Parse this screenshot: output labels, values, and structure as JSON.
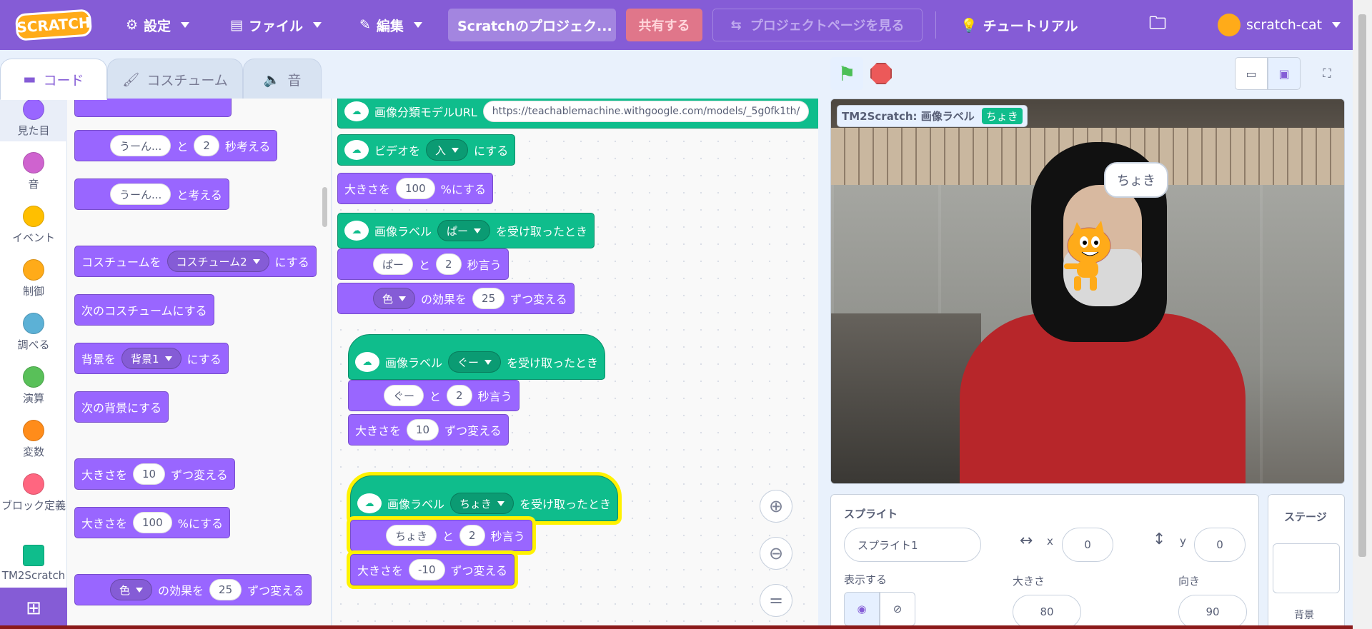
{
  "menubar": {
    "logo": "SCRATCH",
    "settings": "設定",
    "file": "ファイル",
    "edit": "編集",
    "project_title": "Scratchのプロジェク...",
    "share": "共有する",
    "see_project": "プロジェクトページを見る",
    "tutorials": "チュートリアル",
    "username": "scratch-cat"
  },
  "tabs": {
    "code": "コード",
    "costumes": "コスチューム",
    "sounds": "音"
  },
  "categories": [
    {
      "label": "見た目",
      "color": "#9966ff"
    },
    {
      "label": "音",
      "color": "#cf63cf"
    },
    {
      "label": "イベント",
      "color": "#ffbf00"
    },
    {
      "label": "制御",
      "color": "#ffab19"
    },
    {
      "label": "調べる",
      "color": "#5cb1d6"
    },
    {
      "label": "演算",
      "color": "#59c059"
    },
    {
      "label": "変数",
      "color": "#ff8c1a"
    },
    {
      "label": "ブロック定義",
      "color": "#ff6680"
    },
    {
      "label": "TM2Scratch",
      "color": "#0fbd8c"
    }
  ],
  "palette": {
    "b1": {
      "t1": "うーん...",
      "t2": "と",
      "n": "2",
      "t3": "秒考える"
    },
    "b2": {
      "t1": "うーん...",
      "t2": "と考える"
    },
    "b3": {
      "t1": "コスチュームを",
      "dd": "コスチューム2",
      "t2": "にする"
    },
    "b4": {
      "t1": "次のコスチュームにする"
    },
    "b5": {
      "t1": "背景を",
      "dd": "背景1",
      "t2": "にする"
    },
    "b6": {
      "t1": "次の背景にする"
    },
    "b7": {
      "t1": "大きさを",
      "n": "10",
      "t2": "ずつ変える"
    },
    "b8": {
      "t1": "大きさを",
      "n": "100",
      "t2": "%にする"
    },
    "b9": {
      "t1": "色",
      "t2": "の効果を",
      "n": "25",
      "t3": "ずつ変える"
    }
  },
  "scripts": {
    "s1": {
      "model_label": "画像分類モデルURL",
      "url": "https://teachablemachine.withgoogle.com/models/_5g0fk1th/",
      "video_label": "ビデオを",
      "video_dd": "入",
      "video_t2": "にする",
      "size_label": "大きさを",
      "size_n": "100",
      "size_t2": "%にする"
    },
    "s2": {
      "hat1": "画像ラベル",
      "hat_dd": "ぱー",
      "hat2": "を受け取ったとき",
      "say": "ぱー",
      "say_t": "と",
      "say_n": "2",
      "say_t2": "秒言う",
      "fx_dd": "色",
      "fx_t": "の効果を",
      "fx_n": "25",
      "fx_t2": "ずつ変える"
    },
    "s3": {
      "hat1": "画像ラベル",
      "hat_dd": "ぐー",
      "hat2": "を受け取ったとき",
      "say": "ぐー",
      "say_t": "と",
      "say_n": "2",
      "say_t2": "秒言う",
      "size_t": "大きさを",
      "size_n": "10",
      "size_t2": "ずつ変える"
    },
    "s4": {
      "hat1": "画像ラベル",
      "hat_dd": "ちょき",
      "hat2": "を受け取ったとき",
      "say": "ちょき",
      "say_t": "と",
      "say_n": "2",
      "say_t2": "秒言う",
      "size_t": "大きさを",
      "size_n": "-10",
      "size_t2": "ずつ変える"
    }
  },
  "stage": {
    "monitor_label": "TM2Scratch: 画像ラベル",
    "monitor_value": "ちょき",
    "bubble": "ちょき"
  },
  "sprite": {
    "header": "スプライト",
    "name": "スプライト1",
    "x_label": "x",
    "x": "0",
    "y_label": "y",
    "y": "0",
    "show_label": "表示する",
    "size_label": "大きさ",
    "size": "80",
    "dir_label": "向き",
    "dir": "90"
  },
  "stage_pane": {
    "header": "ステージ",
    "backdrops": "背景"
  }
}
